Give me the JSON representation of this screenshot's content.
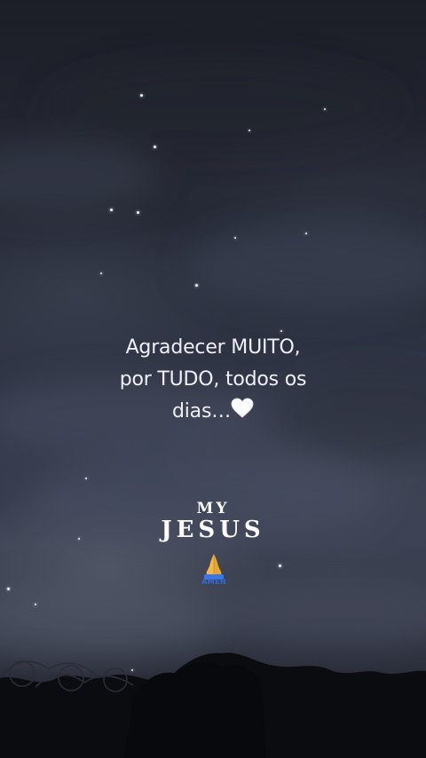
{
  "quote": {
    "line1": "Agradecer MUITO,",
    "line2": "por TUDO, todos os",
    "line3": "dias…",
    "emoji": "white-heart"
  },
  "title": {
    "small": "MY",
    "large": "JESUS"
  },
  "sticker": {
    "icon": "praying-hands-icon",
    "label": "AMEN"
  },
  "colors": {
    "sky_top": "#1c1e27",
    "sky_mid": "#3c4253",
    "ground": "#0d0e12",
    "text": "#eef0f5",
    "amen_blue": "#2f6bd6",
    "hands": "#f4b942"
  }
}
